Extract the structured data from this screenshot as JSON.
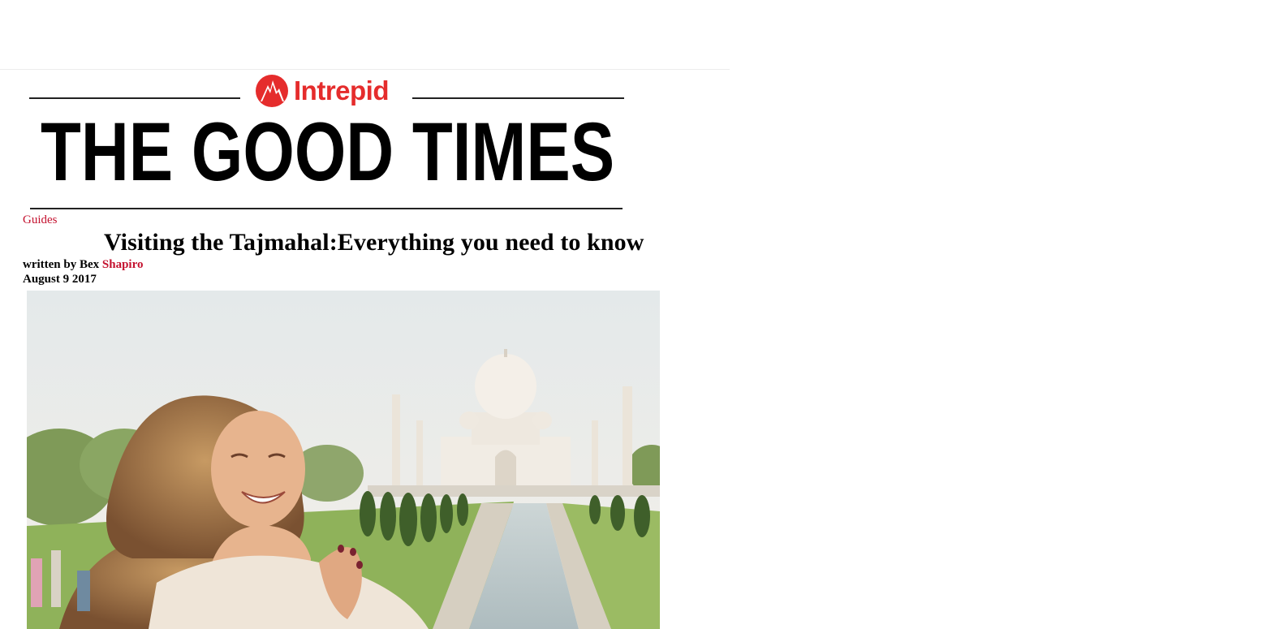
{
  "brand": {
    "name": "Intrepid",
    "masthead": "THE GOOD TIMES",
    "accent_color": "#e52c2c",
    "icon": "intrepid-mountain-sun-icon"
  },
  "article": {
    "category": "Guides",
    "category_color": "#c4122f",
    "title": "Visiting the Tajmahal:Everything you need to know",
    "byline_prefix": "written by Bex",
    "author_surname": "Shapiro",
    "author_color": "#c4122f",
    "date": "August 9 2017",
    "hero_image_alt": "hero-photo"
  }
}
